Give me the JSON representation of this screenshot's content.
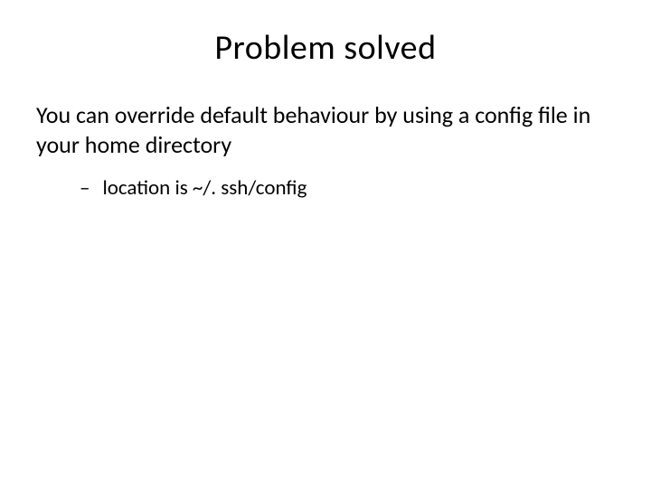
{
  "slide": {
    "title": "Problem solved",
    "body": "You can override default behaviour by using a config file in your home directory",
    "sub_bullet_dash": "–",
    "sub_bullet_text": "location is ~/. ssh/config"
  }
}
